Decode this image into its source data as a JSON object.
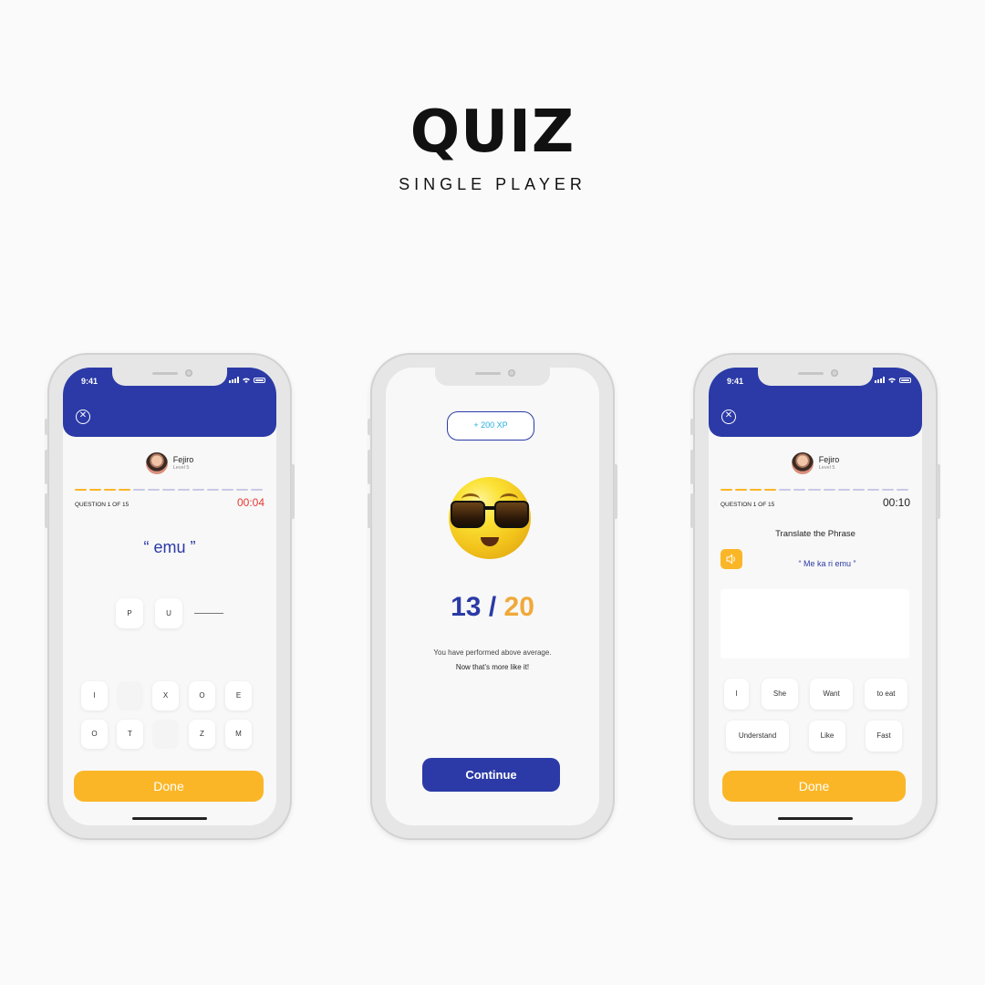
{
  "header": {
    "title": "QUIZ",
    "subtitle": "SINGLE PLAYER"
  },
  "colors": {
    "primary": "#2b3aa6",
    "accent": "#fbb627",
    "timer_red": "#e53935",
    "xp_cyan": "#26b0e0",
    "score_orange": "#f0a93a"
  },
  "phone1": {
    "status_time": "9:41",
    "user": {
      "name": "Fejiro",
      "level": "Level 5"
    },
    "progress": {
      "answered": 4,
      "total": 13
    },
    "question_label": "QUESTION 1 OF 15",
    "timer": "00:04",
    "word": "“ emu ”",
    "answer_slots": [
      "P",
      "U"
    ],
    "letters_row1": [
      "I",
      "",
      "X",
      "O",
      "E"
    ],
    "letters_row2": [
      "O",
      "T",
      "",
      "Z",
      "M"
    ],
    "done_label": "Done",
    "icons": {
      "close": "close-icon",
      "signal": "signal-icon",
      "wifi": "wifi-icon",
      "battery": "battery-icon"
    }
  },
  "phone2": {
    "xp": "+ 200 XP",
    "emoji": "sunglasses-emoji",
    "score": {
      "value": "13",
      "slash": "/",
      "total": "20"
    },
    "message1": "You have performed above average.",
    "message2": "Now that’s more like it!",
    "continue_label": "Continue"
  },
  "phone3": {
    "status_time": "9:41",
    "user": {
      "name": "Fejiro",
      "level": "Level 5"
    },
    "progress": {
      "answered": 4,
      "total": 13
    },
    "question_label": "QUESTION 1 OF 15",
    "timer": "00:10",
    "instruction": "Translate the Phrase",
    "phrase": "“ Me ka ri emu ”",
    "words_row1": [
      "I",
      "She",
      "Want",
      "to eat"
    ],
    "words_row2": [
      "Understand",
      "Like",
      "Fast"
    ],
    "done_label": "Done",
    "icons": {
      "close": "close-icon",
      "speaker": "speaker-icon"
    }
  }
}
